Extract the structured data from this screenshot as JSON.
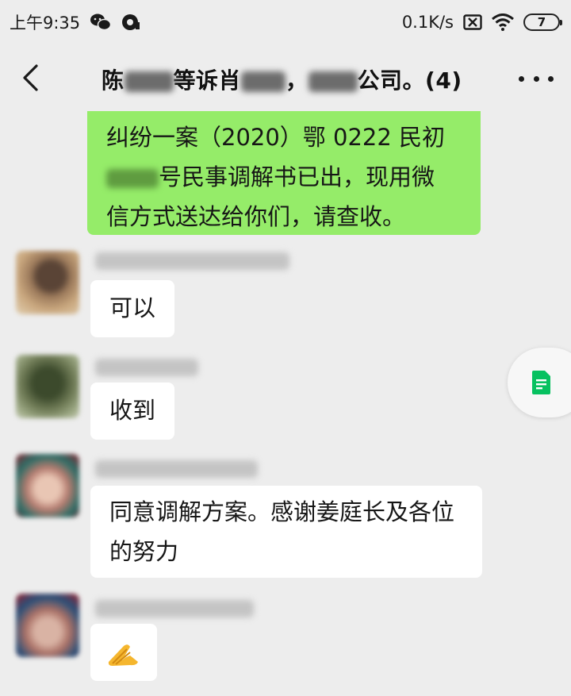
{
  "status_bar": {
    "time": "上午9:35",
    "net_speed": "0.1K/s",
    "battery_level": "7",
    "icons": [
      "wechat-icon",
      "media-icon",
      "sim-off-icon",
      "wifi-icon",
      "battery-icon"
    ]
  },
  "header": {
    "title_part1": "陈",
    "title_part2": "等诉肖",
    "title_part3": "，",
    "title_part4": "公司。(4)",
    "back_icon": "chevron-left-icon",
    "more_icon": "more-dots-icon"
  },
  "messages": [
    {
      "from": "me",
      "text_lines": [
        "纠纷一案（2020）鄂 0222 民初",
        "号民事调解书已出，现用微",
        "信方式送达给你们，请查收。"
      ]
    },
    {
      "from": "member-1",
      "text": "可以"
    },
    {
      "from": "member-2",
      "text": "收到"
    },
    {
      "from": "member-3",
      "text_lines": [
        "同意调解方案。感谢姜庭长及各位",
        "的努力"
      ]
    },
    {
      "from": "member-4",
      "emoji": "clap-emoji"
    }
  ],
  "floating_tab": {
    "icon": "document-icon"
  },
  "colors": {
    "background": "#ededed",
    "my_bubble": "#95ec69",
    "other_bubble": "#ffffff",
    "accent_green": "#07c160"
  }
}
